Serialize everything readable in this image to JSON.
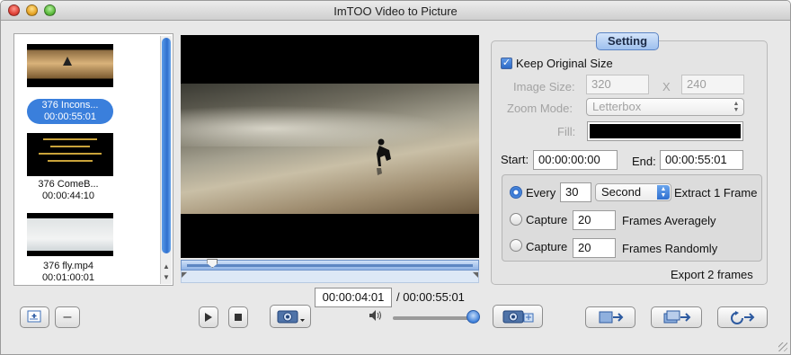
{
  "window": {
    "title": "ImTOO Video to Picture"
  },
  "thumbnails": [
    {
      "name": "376 Incons...",
      "duration": "00:00:55:01",
      "selected": true
    },
    {
      "name": "376 ComeB...",
      "duration": "00:00:44:10",
      "selected": false
    },
    {
      "name": "376 fly.mp4",
      "duration": "00:01:00:01",
      "selected": false
    }
  ],
  "setting": {
    "tab_label": "Setting",
    "keep_original_size": {
      "label": "Keep Original Size",
      "checked": true
    },
    "image_size": {
      "label": "Image Size:",
      "width": "320",
      "separator": "X",
      "height": "240"
    },
    "zoom_mode": {
      "label": "Zoom Mode:",
      "value": "Letterbox"
    },
    "fill": {
      "label": "Fill:",
      "color": "#000000"
    },
    "start": {
      "label": "Start:",
      "value": "00:00:00:00"
    },
    "end": {
      "label": "End:",
      "value": "00:00:55:01"
    },
    "every": {
      "label": "Every",
      "value": "30",
      "unit": "Second",
      "suffix": "Extract 1 Frame",
      "selected": true
    },
    "capture_avg": {
      "label": "Capture",
      "value": "20",
      "suffix": "Frames Averagely",
      "selected": false
    },
    "capture_rand": {
      "label": "Capture",
      "value": "20",
      "suffix": "Frames Randomly",
      "selected": false
    },
    "export_summary": "Export 2 frames"
  },
  "playback": {
    "current_time": "00:00:04:01",
    "total_time": "/ 00:00:55:01",
    "progress": 0.073,
    "volume": 1.0
  },
  "toolbar": {
    "add_label": "+",
    "remove_label": "–",
    "icons": {
      "add": "add-file-icon",
      "remove": "remove-icon",
      "play": "play-icon",
      "stop": "stop-icon",
      "snapshot": "camera-icon",
      "volume": "speaker-icon",
      "snapshot_settings": "camera-settings-icon",
      "export_1": "export-icon",
      "export_2": "export-batch-icon",
      "convert": "convert-icon"
    }
  },
  "colors": {
    "accent": "#3a7fdc",
    "selection": "#3a7fdc"
  }
}
